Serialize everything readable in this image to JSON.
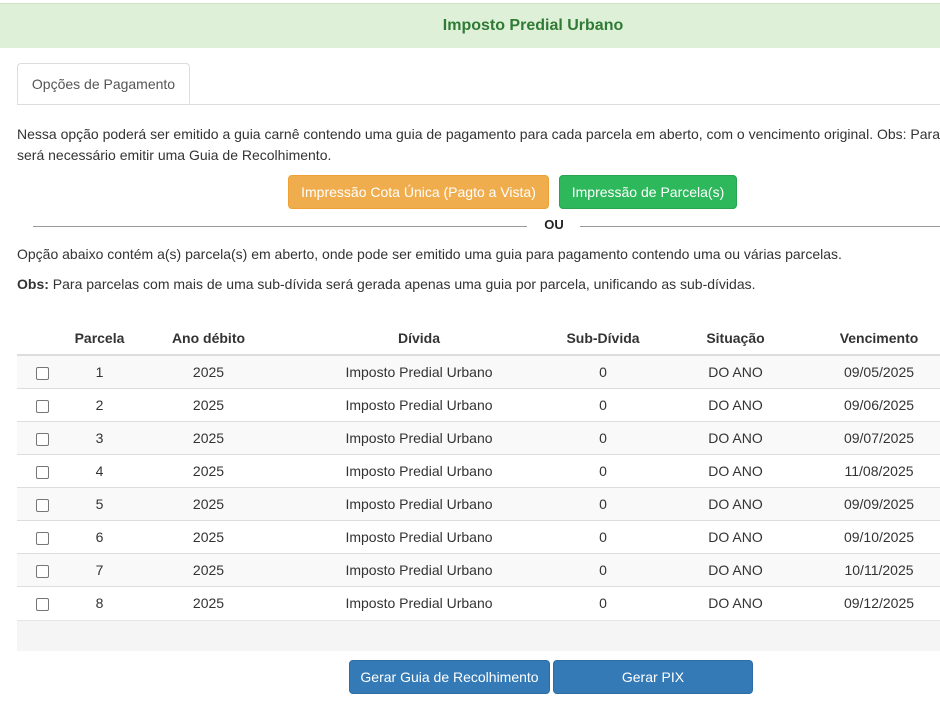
{
  "header": {
    "title": "Imposto Predial Urbano"
  },
  "tabs": [
    {
      "label": "Opções de Pagamento"
    }
  ],
  "description": {
    "line1": "Nessa opção poderá ser emitido a guia carnê contendo uma guia de pagamento para cada parcela em aberto, com o vencimento original. Obs: Para",
    "line2": "será necessário emitir uma Guia de Recolhimento."
  },
  "buttons": {
    "cota_unica": "Impressão Cota Única (Pagto a Vista)",
    "parcelas": "Impressão de Parcela(s)",
    "gerar_guia": "Gerar Guia de Recolhimento",
    "gerar_pix": "Gerar PIX"
  },
  "divider_text": "OU",
  "info": {
    "text1": "Opção abaixo contém a(s) parcela(s) em aberto, onde pode ser emitido uma guia para pagamento contendo uma ou várias parcelas.",
    "obs_label": "Obs:",
    "obs_text": " Para parcelas com mais de uma sub-dívida será gerada apenas uma guia por parcela, unificando as sub-dívidas."
  },
  "table": {
    "headers": [
      "",
      "Parcela",
      "Ano débito",
      "Dívida",
      "Sub-Dívida",
      "Situação",
      "Vencimento"
    ],
    "rows": [
      {
        "parcela": "1",
        "ano": "2025",
        "divida": "Imposto Predial Urbano",
        "subdivida": "0",
        "situacao": "DO ANO",
        "vencimento": "09/05/2025"
      },
      {
        "parcela": "2",
        "ano": "2025",
        "divida": "Imposto Predial Urbano",
        "subdivida": "0",
        "situacao": "DO ANO",
        "vencimento": "09/06/2025"
      },
      {
        "parcela": "3",
        "ano": "2025",
        "divida": "Imposto Predial Urbano",
        "subdivida": "0",
        "situacao": "DO ANO",
        "vencimento": "09/07/2025"
      },
      {
        "parcela": "4",
        "ano": "2025",
        "divida": "Imposto Predial Urbano",
        "subdivida": "0",
        "situacao": "DO ANO",
        "vencimento": "11/08/2025"
      },
      {
        "parcela": "5",
        "ano": "2025",
        "divida": "Imposto Predial Urbano",
        "subdivida": "0",
        "situacao": "DO ANO",
        "vencimento": "09/09/2025"
      },
      {
        "parcela": "6",
        "ano": "2025",
        "divida": "Imposto Predial Urbano",
        "subdivida": "0",
        "situacao": "DO ANO",
        "vencimento": "09/10/2025"
      },
      {
        "parcela": "7",
        "ano": "2025",
        "divida": "Imposto Predial Urbano",
        "subdivida": "0",
        "situacao": "DO ANO",
        "vencimento": "10/11/2025"
      },
      {
        "parcela": "8",
        "ano": "2025",
        "divida": "Imposto Predial Urbano",
        "subdivida": "0",
        "situacao": "DO ANO",
        "vencimento": "09/12/2025"
      }
    ]
  },
  "colors": {
    "header_bg": "#dff0d8",
    "header_text": "#2f7a35",
    "orange": "#f0ad4e",
    "green": "#2eb85c",
    "blue": "#337ab7"
  }
}
